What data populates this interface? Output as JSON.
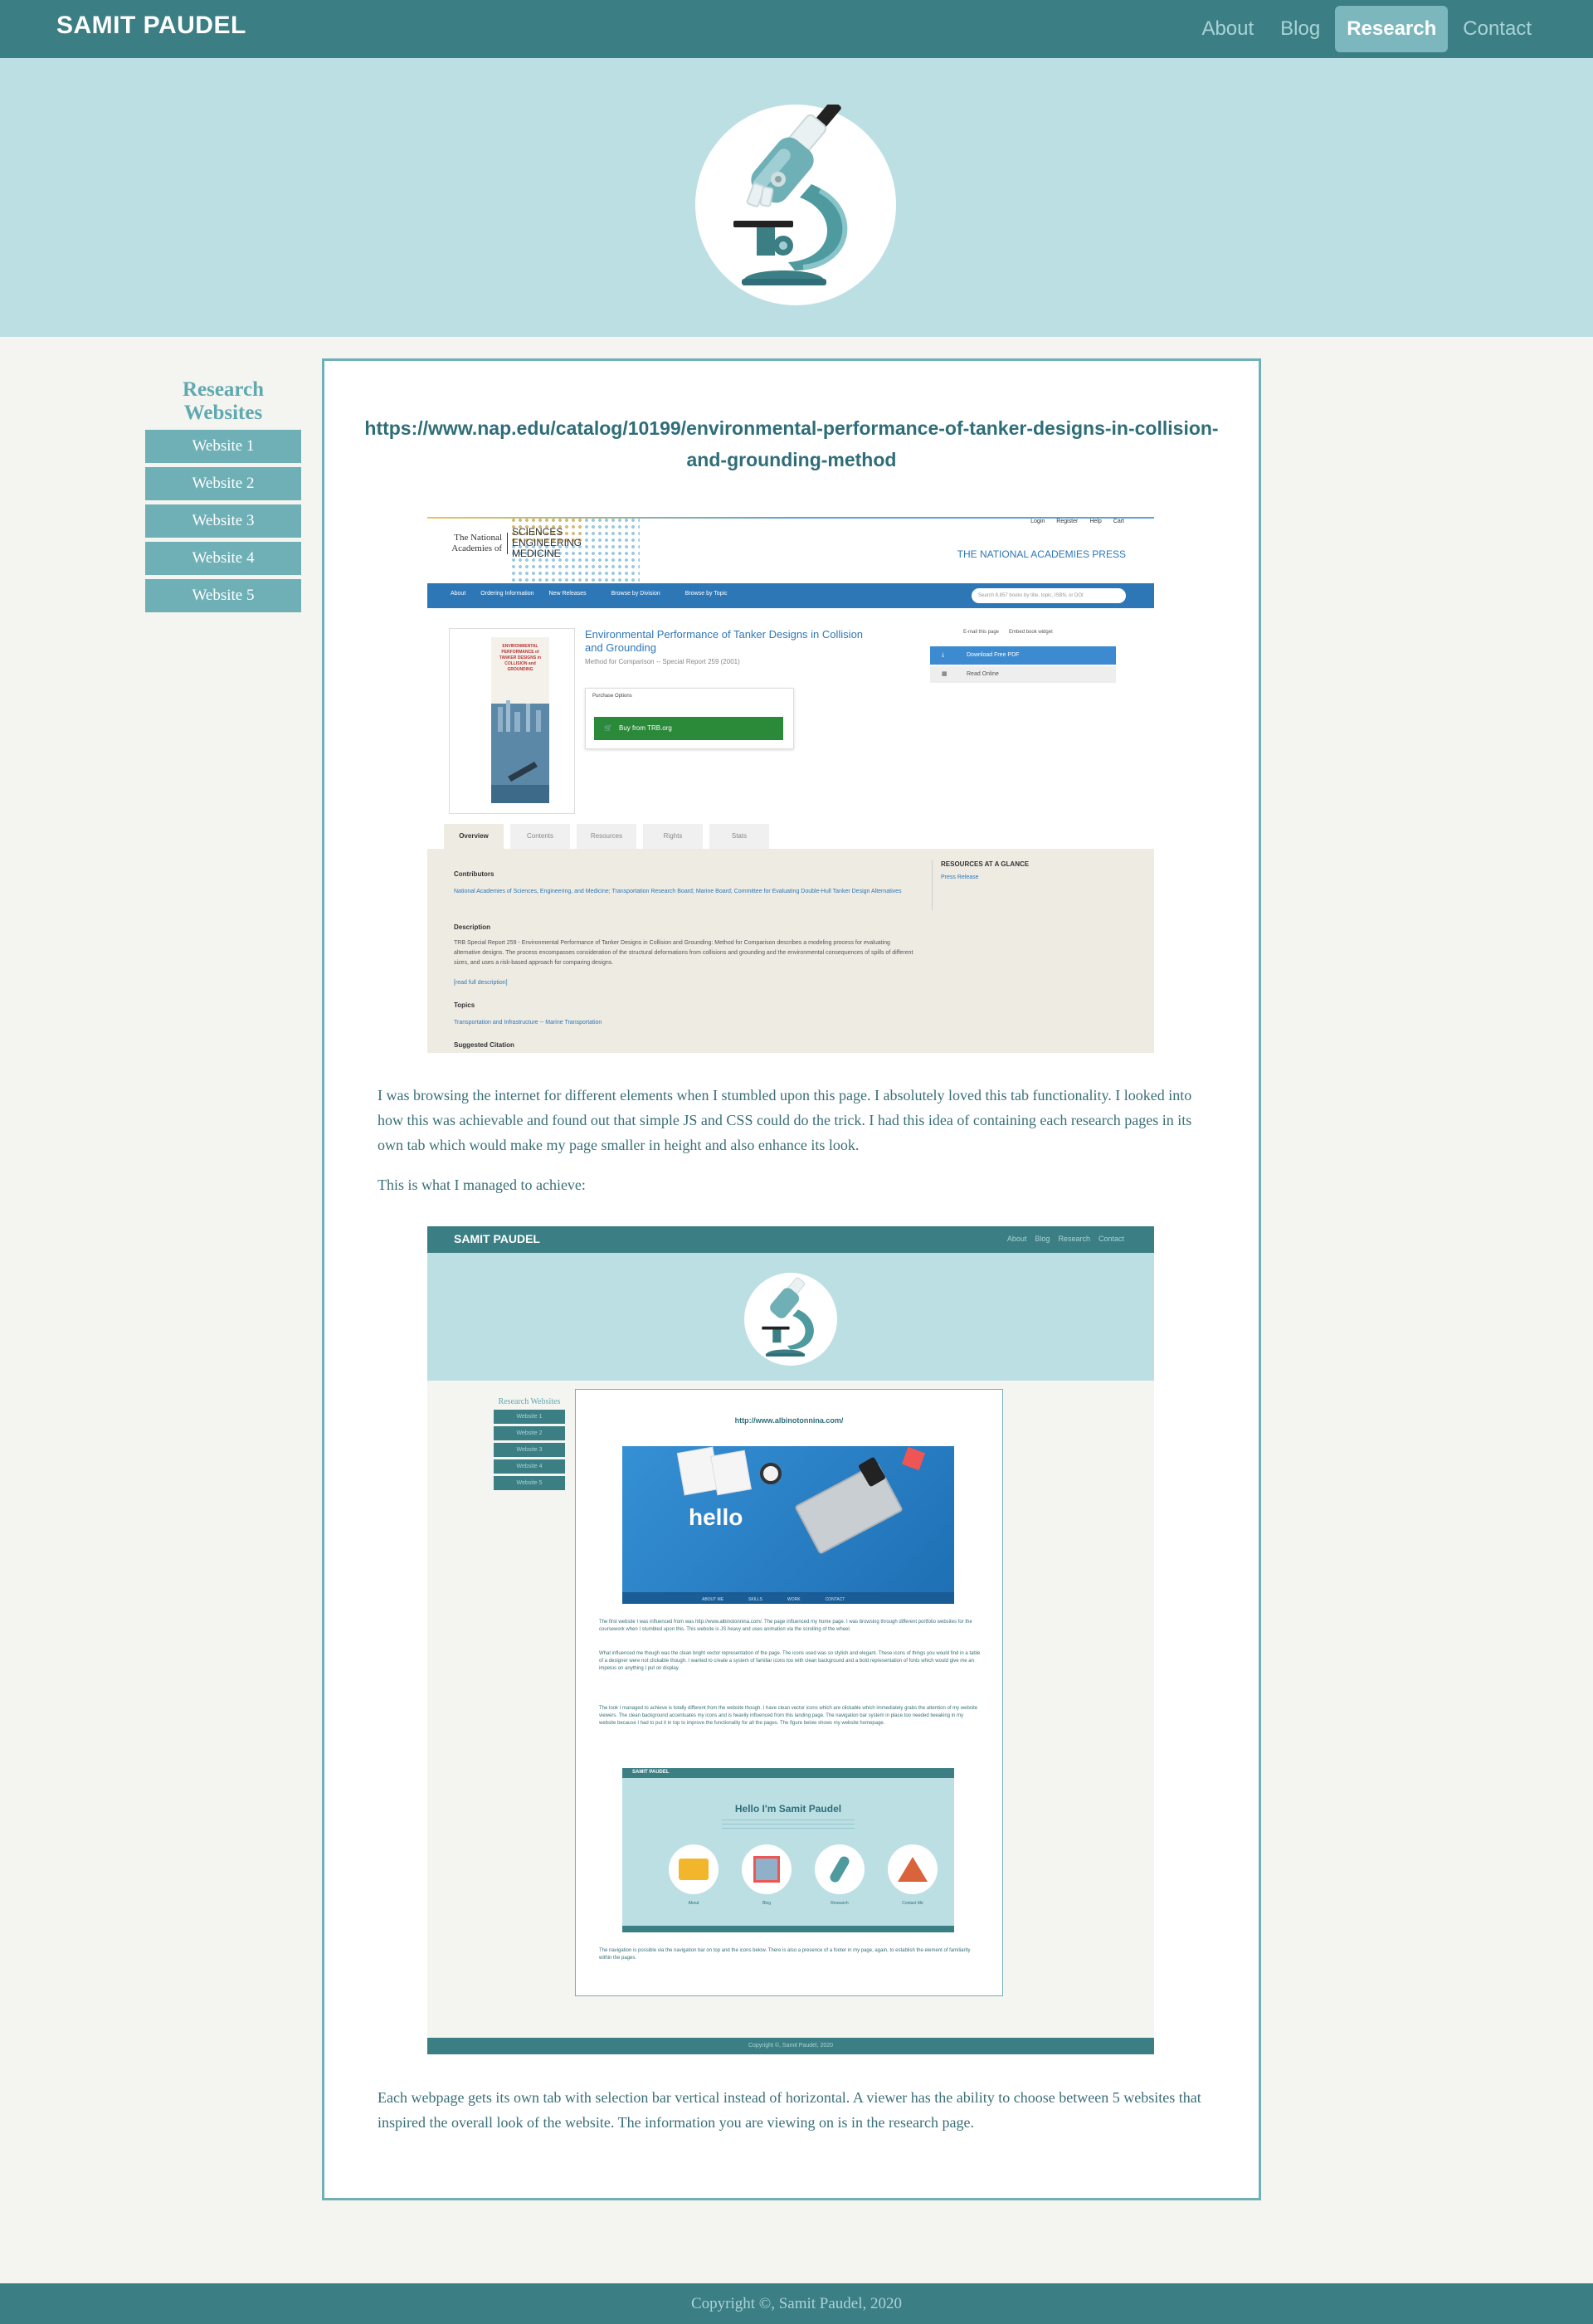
{
  "header": {
    "brand": "SAMIT PAUDEL",
    "nav": [
      "About",
      "Blog",
      "Research",
      "Contact"
    ],
    "active": "Research"
  },
  "sidebar": {
    "title": "Research Websites",
    "tabs": [
      "Website 1",
      "Website 2",
      "Website 3",
      "Website 4",
      "Website 5"
    ]
  },
  "main": {
    "url_heading": "https://www.nap.edu/catalog/10199/environmental-performance-of-tanker-designs-in-collision-and-grounding-method",
    "paragraph1": "I was browsing the internet for different elements when I stumbled upon this page. I absolutely loved this tab functionality. I looked into how this was achievable and found out that simple JS and CSS could do the trick. I had this idea of containing each research pages in its own tab which would make my page smaller in height and also enhance its look.",
    "paragraph2": "This is what I managed to achieve:",
    "paragraph3": "Each webpage gets its own tab with selection bar vertical instead of horizontal. A viewer has the ability to choose between 5 websites that inspired the overall look of the website. The information you are viewing on is in the research page."
  },
  "nap_screenshot": {
    "logo_left": "The National Academies of",
    "logo_right": [
      "SCIENCES",
      "ENGINEERING",
      "MEDICINE"
    ],
    "util_links": [
      "Login",
      "Register",
      "Help",
      "Cart"
    ],
    "press": "THE NATIONAL ACADEMIES PRESS",
    "nav": [
      "About",
      "Ordering Information",
      "New Releases",
      "Browse by Division",
      "Browse by Topic"
    ],
    "search_placeholder": "Search 8,857 books by title, topic, ISBN, or DOI",
    "book_cover_title": "ENVIRONMENTAL PERFORMANCE of TANKER DESIGNS in COLLISION and GROUNDING",
    "title": "Environmental Performance of Tanker Designs in Collision and Grounding",
    "subtitle": "Method for Comparison -- Special Report 259 (2001)",
    "purchase_label": "Purchase Options",
    "buy_label": "Buy from TRB.org",
    "share": [
      "E-mail this page",
      "Embed book widget"
    ],
    "download_label": "Download Free PDF",
    "read_label": "Read Online",
    "tabs": [
      "Overview",
      "Contents",
      "Resources",
      "Rights",
      "Stats"
    ],
    "contributors_h": "Contributors",
    "contributors_t": "National Academies of Sciences, Engineering, and Medicine; Transportation Research Board; Marine Board; Committee for Evaluating Double-Hull Tanker Design Alternatives",
    "description_h": "Description",
    "description_t": "TRB Special Report 259 - Environmental Performance of Tanker Designs in Collision and Grounding: Method for Comparison describes a modeling process for evaluating alternative designs. The process encompasses consideration of the structural deformations from collisions and grounding and the environmental consequences of spills of different sizes, and uses a risk-based approach for comparing designs.",
    "read_full": "[read full description]",
    "topics_h": "Topics",
    "topics_t": "Transportation and Infrastructure -- Marine Transportation",
    "citation_h": "Suggested Citation",
    "rag_h": "RESOURCES AT A GLANCE",
    "rag_link": "Press Release"
  },
  "site_screenshot": {
    "brand": "SAMIT PAUDEL",
    "nav": [
      "About",
      "Blog",
      "Research",
      "Contact"
    ],
    "side_title": "Research Websites",
    "tabs": [
      "Website 1",
      "Website 2",
      "Website 3",
      "Website 4",
      "Website 5"
    ],
    "url": "http://www.albinotonnina.com/",
    "hello": "hello",
    "hello_nav": [
      "ABOUT ME",
      "SKILLS",
      "WORK",
      "CONTACT"
    ],
    "text1": "The first website I was influenced from was http://www.albinotonnina.com/. The page influenced my home page. I was browsing through different portfolio websites for the coursework when I stumbled upon this. This website is JS heavy and uses animation via the scrolling of the wheel.",
    "text2": "What influenced me though was the clean bright vector representation of the page. The icons used was so stylish and elegant. These icons of things you would find in a table of a designer were not clickable though. I wanted to create a system of familiar icons too with clean background and a bold representation of fonts which would give me an impetus on anything I put on display.",
    "text3": "The look I managed to achieve is totally different from the website though. I have clean vector icons which are clickable which immediately grabs the attention of my website viewers. The clean background accentuates my icons and is heavily influenced from this landing page. The navigation bar system in place too needed tweaking in my website because I had to put it in top to improve the functionality for all the pages. The figure below shows my website homepage.",
    "mini_brand": "SAMIT PAUDEL",
    "mini_hello": "Hello I'm Samit Paudel",
    "mini_labels": [
      "About",
      "Blog",
      "Research",
      "Contact Me"
    ],
    "text4": "The navigation is possible via the navigation bar on top and the icons below. There is also a presence of a footer in my page, again, to establish the element of familiarity within the pages.",
    "footer": "Copyright ©, Samit Paudel, 2020"
  },
  "footer": {
    "text": "Copyright ©, Samit Paudel, 2020"
  },
  "colors": {
    "nav": "#3b7f84",
    "hero": "#bcdfe4",
    "accent": "#6fb0b6",
    "background": "#f4f4f0"
  },
  "icons": [
    "microscope-icon",
    "cart-icon",
    "download-icon",
    "search-icon"
  ]
}
